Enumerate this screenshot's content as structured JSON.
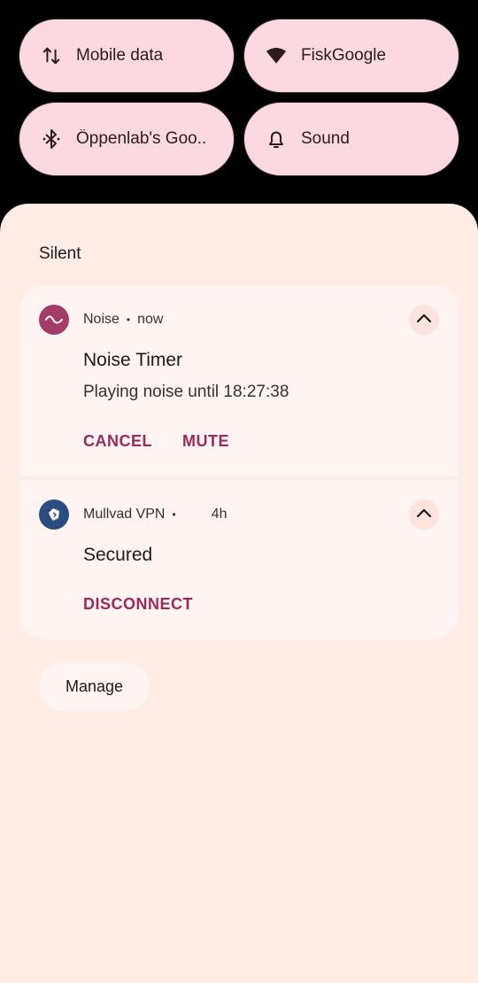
{
  "quick_settings": {
    "tiles": [
      {
        "label": "Mobile data",
        "icon": "mobile-data-icon"
      },
      {
        "label": "FiskGoogle",
        "icon": "wifi-icon"
      },
      {
        "label": "Öppenlab's Goo..",
        "icon": "bluetooth-icon"
      },
      {
        "label": "Sound",
        "icon": "bell-icon"
      }
    ]
  },
  "shade": {
    "section_title": "Silent",
    "notifications": [
      {
        "app": "Noise",
        "separator": "•",
        "time": "now",
        "title": "Noise Timer",
        "text": "Playing noise until 18:27:38",
        "actions": [
          "CANCEL",
          "MUTE"
        ]
      },
      {
        "app": "Mullvad VPN",
        "separator": "•",
        "time": "4h",
        "title": "Secured",
        "actions": [
          "DISCONNECT"
        ]
      }
    ],
    "manage_label": "Manage"
  },
  "colors": {
    "tile_bg": "#fcd8e0",
    "shade_bg": "#ffece4",
    "card_bg": "#fff4f1",
    "accent": "#9a2a5a",
    "noise_icon_bg": "#a33c66",
    "mullvad_icon_bg": "#294d80"
  }
}
